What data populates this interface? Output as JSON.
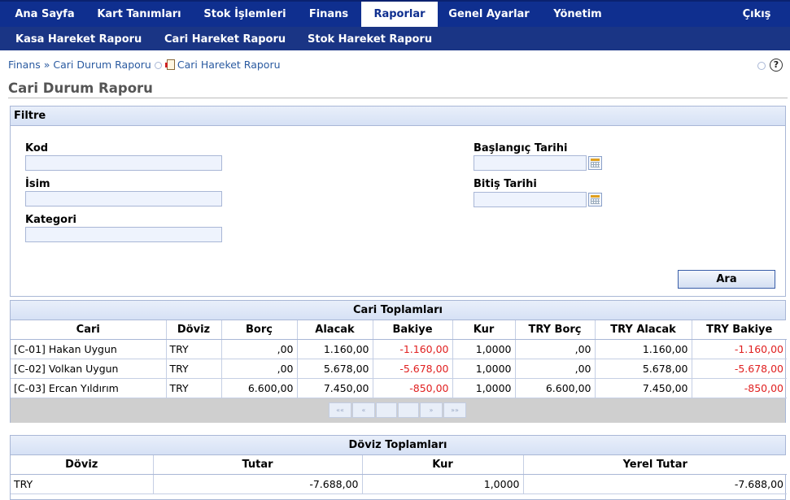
{
  "topnav": {
    "items": [
      {
        "label": "Ana Sayfa"
      },
      {
        "label": "Kart Tanımları"
      },
      {
        "label": "Stok İşlemleri"
      },
      {
        "label": "Finans"
      },
      {
        "label": "Raporlar"
      },
      {
        "label": "Genel Ayarlar"
      },
      {
        "label": "Yönetim"
      }
    ],
    "exit_label": "Çıkış",
    "active": "Raporlar"
  },
  "subnav": {
    "items": [
      {
        "label": "Kasa Hareket Raporu"
      },
      {
        "label": "Cari Hareket Raporu"
      },
      {
        "label": "Stok Hareket Raporu"
      }
    ]
  },
  "breadcrumb": {
    "root": "Finans",
    "separator": "»",
    "current": "Cari Durum Raporu",
    "related_link": "Cari Hareket Raporu"
  },
  "help_icon_text": "?",
  "page_title": "Cari Durum Raporu",
  "filter": {
    "title": "Filtre",
    "kod_label": "Kod",
    "kod_value": "",
    "isim_label": "İsim",
    "isim_value": "",
    "kategori_label": "Kategori",
    "kategori_value": "",
    "baslangic_label": "Başlangıç Tarihi",
    "baslangic_value": "",
    "bitis_label": "Bitiş Tarihi",
    "bitis_value": "",
    "search_button": "Ara"
  },
  "cari_toplamlari": {
    "caption": "Cari Toplamları",
    "headers": [
      "Cari",
      "Döviz",
      "Borç",
      "Alacak",
      "Bakiye",
      "Kur",
      "TRY Borç",
      "TRY Alacak",
      "TRY Bakiye"
    ],
    "rows": [
      [
        "[C-01] Hakan Uygun",
        "TRY",
        ",00",
        "1.160,00",
        "-1.160,00",
        "1,0000",
        ",00",
        "1.160,00",
        "-1.160,00"
      ],
      [
        "[C-02] Volkan Uygun",
        "TRY",
        ",00",
        "5.678,00",
        "-5.678,00",
        "1,0000",
        ",00",
        "5.678,00",
        "-5.678,00"
      ],
      [
        "[C-03] Ercan Yıldırım",
        "TRY",
        "6.600,00",
        "7.450,00",
        "-850,00",
        "1,0000",
        "6.600,00",
        "7.450,00",
        "-850,00"
      ]
    ],
    "pager": [
      "««",
      "«",
      "",
      "",
      "»",
      "»»"
    ]
  },
  "doviz_toplamlari": {
    "caption": "Döviz Toplamları",
    "headers": [
      "Döviz",
      "Tutar",
      "Kur",
      "Yerel Tutar"
    ],
    "rows": [
      [
        "TRY",
        "-7.688,00",
        "1,0000",
        "-7.688,00"
      ]
    ]
  },
  "colors": {
    "nav_bg": "#0f2f8f",
    "subnav_bg": "#1a3585",
    "negative": "#e02020",
    "panel_border": "#a9b7d6"
  }
}
